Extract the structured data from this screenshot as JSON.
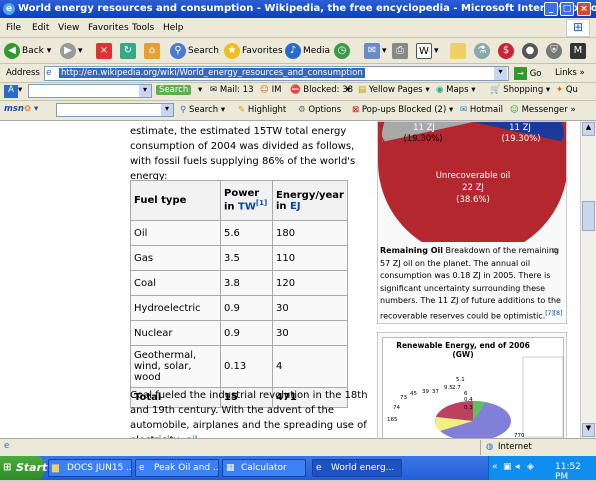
{
  "window": {
    "title": "World energy resources and consumption - Wikipedia, the free encyclopedia - Microsoft Internet Explorer"
  },
  "menu": [
    "File",
    "Edit",
    "View",
    "Favorites",
    "Tools",
    "Help"
  ],
  "toolbar": {
    "back": "Back",
    "search": "Search",
    "favorites": "Favorites",
    "media": "Media"
  },
  "address": {
    "label": "Address",
    "url": "http://en.wikipedia.org/wiki/World_energy_resources_and_consumption",
    "go": "Go",
    "links": "Links"
  },
  "toolbar3": {
    "search_btn": "Search",
    "mail": "Mail: 13",
    "im": "IM",
    "blocked": "Blocked: 38",
    "yellow_pages": "Yellow Pages",
    "maps": "Maps",
    "shopping": "Shopping",
    "extra": "Qu"
  },
  "toolbar4": {
    "msn": "msn",
    "search": "Search",
    "highlight": "Highlight",
    "options": "Options",
    "popups": "Pop-ups Blocked (2)",
    "hotmail": "Hotmail",
    "messenger": "Messenger"
  },
  "article": {
    "intro": "estimate, the estimated 15TW total energy consumption of 2004 was divided as follows, with fossil fuels supplying 86% of the world's energy:",
    "headers": {
      "fuel": "Fuel type",
      "power": "Power in TW",
      "power_link": "TW",
      "power_ref": "[1]",
      "energy": "Energy/year in EJ",
      "energy_link": "EJ"
    },
    "rows": [
      {
        "fuel": "Oil",
        "power": "5.6",
        "energy": "180"
      },
      {
        "fuel": "Gas",
        "power": "3.5",
        "energy": "110"
      },
      {
        "fuel": "Coal",
        "power": "3.8",
        "energy": "120"
      },
      {
        "fuel": "Hydroelectric",
        "power": "0.9",
        "energy": "30"
      },
      {
        "fuel": "Nuclear",
        "power": "0.9",
        "energy": "30"
      },
      {
        "fuel": "Geothermal, wind, solar, wood",
        "power": "0.13",
        "energy": "4"
      }
    ],
    "total": {
      "fuel": "Total",
      "power": "15",
      "energy": "471"
    },
    "after": "Coal fueled the industrial revolution in the 18th and 19th century. With the advent of the automobile, airplanes and the spreading use of electricity,",
    "after_link": "oil"
  },
  "pie": {
    "label_left": "11 ZJ",
    "pct_left": "(19.30%)",
    "label_right": "11 ZJ",
    "pct_right": "(19.30%)",
    "unrec_label": "Unrecoverable oil",
    "unrec_value": "22 ZJ",
    "unrec_pct": "(38.6%)",
    "colors": {
      "red": "#b5272e",
      "grey": "#a8a8a8",
      "blue": "#1a3a9a"
    }
  },
  "caption": {
    "bold": "Remaining Oil",
    "text": " Breakdown of the remaining 57 ZJ oil on the planet. The annual oil consumption was 0.18 ZJ in 2005. There is significant uncertainty surrounding these numbers. The 11 ZJ of future additions to the recoverable reserves could be optimistic.",
    "refs": "[7][8]"
  },
  "chart2": {
    "title": "Renewable Energy, end of 2006  (GW)",
    "labels": [
      "74",
      "165",
      "73",
      "45",
      "39",
      "37",
      "9.5",
      "2.7",
      "5.1",
      "6",
      "0.4",
      "0.3",
      "770"
    ]
  },
  "status": {
    "zone": "Internet"
  },
  "taskbar": {
    "start": "Start",
    "tasks": [
      "DOCS JUN15 ...",
      "Peak Oil and ...",
      "Calculator",
      "World energ..."
    ],
    "time": "11:52 PM"
  }
}
